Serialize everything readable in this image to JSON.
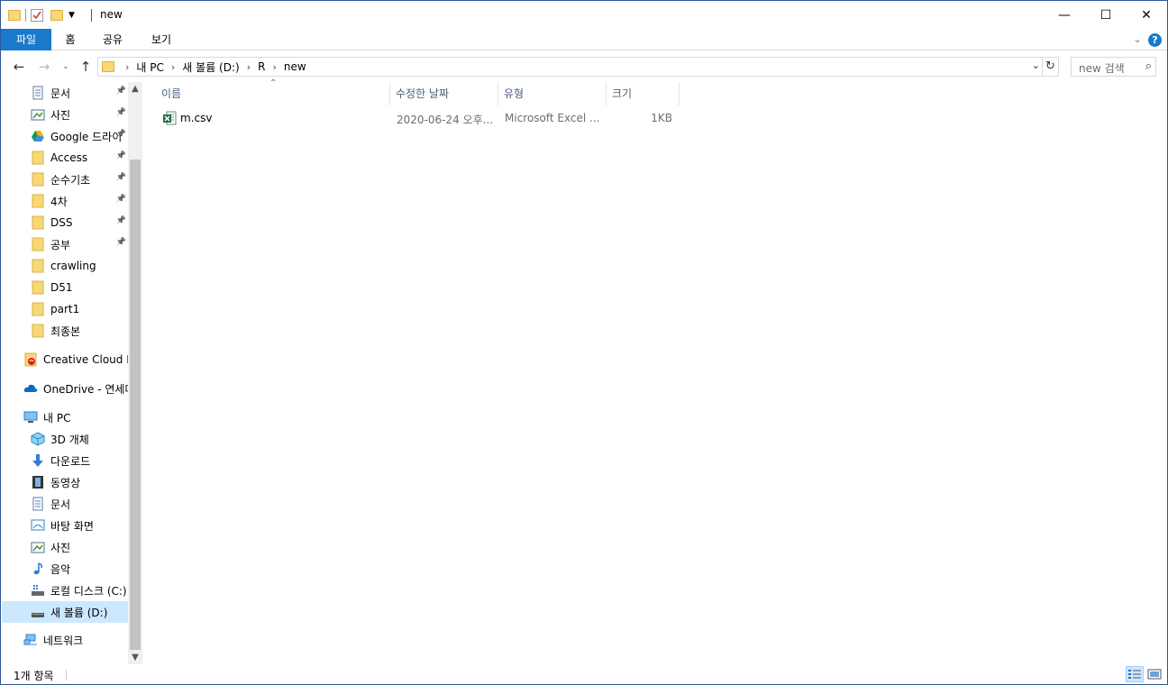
{
  "window": {
    "title": "new",
    "controls": {
      "minimize": "—",
      "maximize": "☐",
      "close": "✕"
    }
  },
  "ribbon": {
    "tabs": [
      "파일",
      "홈",
      "공유",
      "보기"
    ],
    "help": "?"
  },
  "address": {
    "crumbs": [
      "내 PC",
      "새 볼륨 (D:)",
      "R",
      "new"
    ],
    "search_placeholder": "new 검색"
  },
  "navpane": {
    "quick_access": [
      {
        "label": "문서",
        "icon": "documents-icon",
        "pinned": true
      },
      {
        "label": "사진",
        "icon": "pictures-icon",
        "pinned": true
      },
      {
        "label": "Google 드라이",
        "icon": "google-drive-icon",
        "pinned": true
      },
      {
        "label": "Access",
        "icon": "folder-icon",
        "pinned": true
      },
      {
        "label": "순수기초",
        "icon": "folder-icon",
        "pinned": true
      },
      {
        "label": "4차",
        "icon": "folder-icon",
        "pinned": true
      },
      {
        "label": "DSS",
        "icon": "folder-icon",
        "pinned": true
      },
      {
        "label": "공부",
        "icon": "folder-icon",
        "pinned": true
      },
      {
        "label": "crawling",
        "icon": "folder-icon",
        "pinned": false
      },
      {
        "label": "D51",
        "icon": "folder-icon",
        "pinned": false
      },
      {
        "label": "part1",
        "icon": "folder-icon",
        "pinned": false
      },
      {
        "label": "최종본",
        "icon": "folder-icon",
        "pinned": false
      }
    ],
    "creative_cloud": "Creative Cloud Fil",
    "onedrive": "OneDrive - 연세대",
    "this_pc": "내 PC",
    "pc_items": [
      {
        "label": "3D 개체",
        "icon": "3d-objects-icon"
      },
      {
        "label": "다운로드",
        "icon": "downloads-icon"
      },
      {
        "label": "동영상",
        "icon": "videos-icon"
      },
      {
        "label": "문서",
        "icon": "documents-icon"
      },
      {
        "label": "바탕 화면",
        "icon": "desktop-icon"
      },
      {
        "label": "사진",
        "icon": "pictures-icon"
      },
      {
        "label": "음악",
        "icon": "music-icon"
      },
      {
        "label": "로컬 디스크 (C:)",
        "icon": "local-disk-icon"
      },
      {
        "label": "새 볼륨 (D:)",
        "icon": "drive-icon"
      }
    ],
    "network": "네트워크"
  },
  "columns": [
    "이름",
    "수정한 날짜",
    "유형",
    "크기"
  ],
  "files": [
    {
      "name": "m.csv",
      "modified": "2020-06-24 오후...",
      "type": "Microsoft Excel ...",
      "size": "1KB"
    }
  ],
  "status": {
    "item_count": "1개 항목"
  },
  "colors": {
    "accent": "#1979ca",
    "selection": "#cce8ff",
    "folder": "#f8d775"
  }
}
